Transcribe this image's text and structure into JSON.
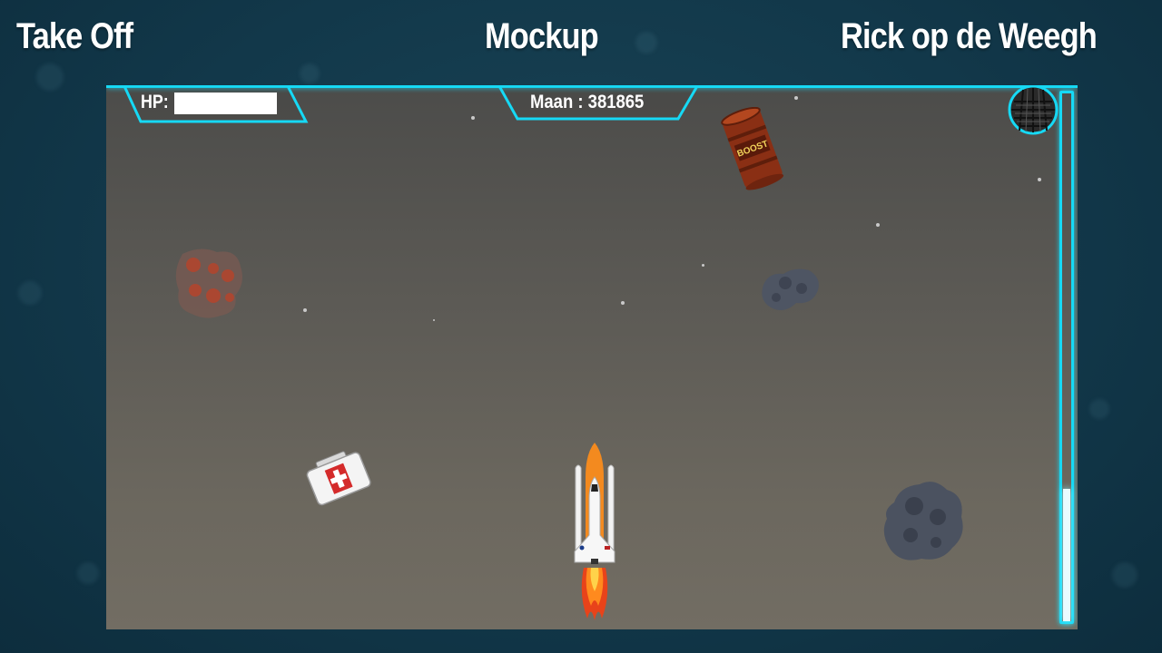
{
  "header": {
    "left_title": "Take Off",
    "center_title": "Mockup",
    "right_title": "Rick op de Weegh"
  },
  "hud": {
    "hp_label": "HP:",
    "hp_fraction": 1.0,
    "distance_text": "Maan : 381865",
    "boost_level_fraction": 0.25,
    "frame_color": "#16d9f5"
  },
  "sprites": {
    "barrel_label": "BOOST",
    "icons": [
      "rocket-shuttle-icon",
      "boost-barrel-icon",
      "medkit-icon",
      "asteroid-icon",
      "damaged-asteroid-icon",
      "net-ball-icon"
    ]
  }
}
